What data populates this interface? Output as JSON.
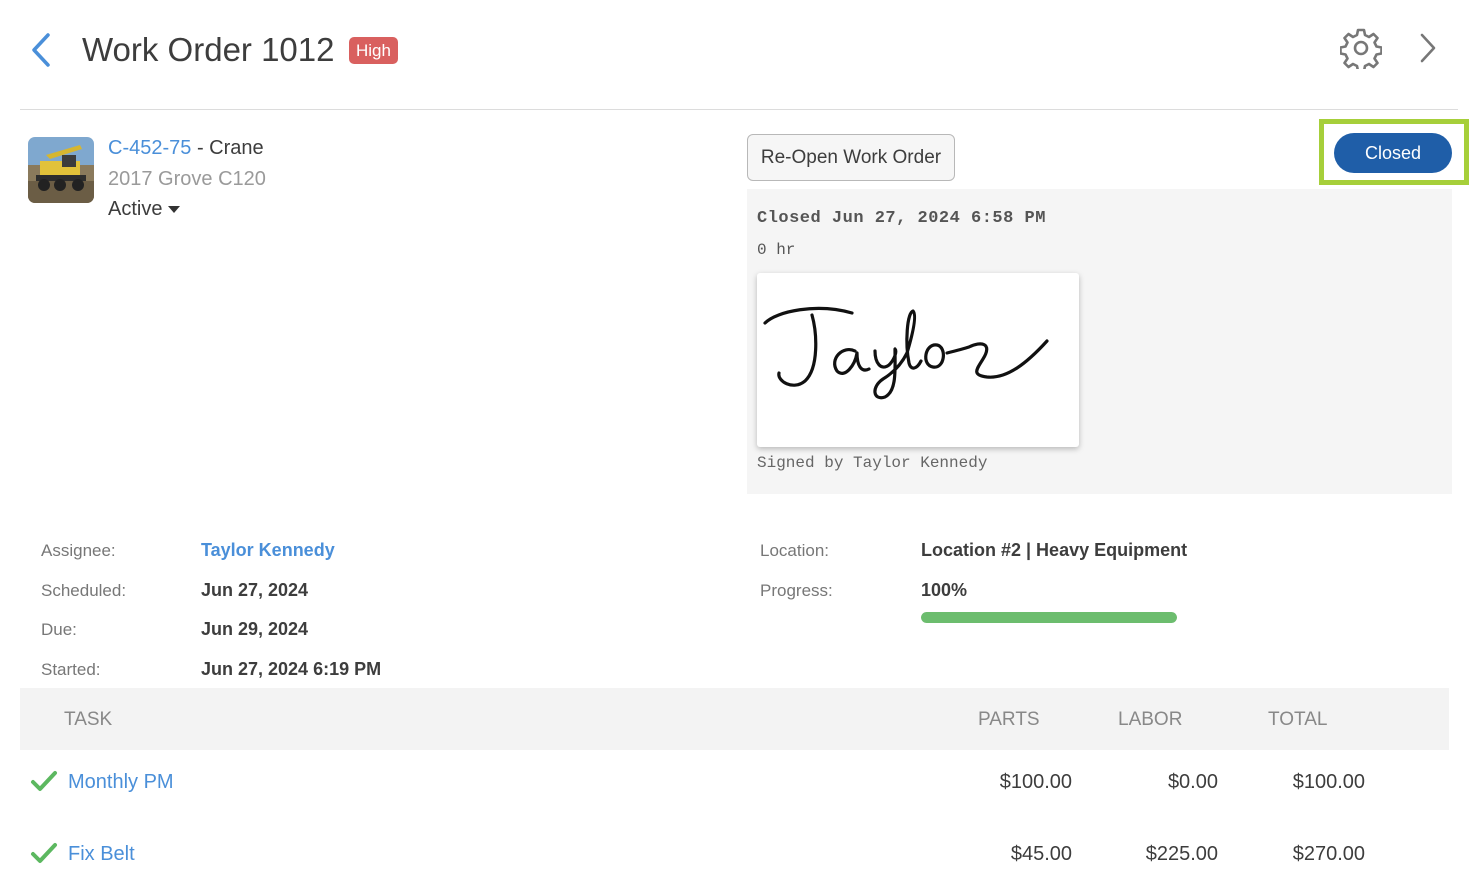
{
  "header": {
    "title": "Work Order 1012",
    "priority": "High"
  },
  "asset": {
    "id": "C-452-75",
    "separator": " - ",
    "name": "Crane",
    "model": "2017 Grove C120",
    "status": "Active"
  },
  "actions": {
    "reopen_label": "Re-Open Work Order",
    "status_label": "Closed"
  },
  "closure": {
    "closed_text": "Closed Jun 27, 2024 6:58 PM",
    "hours_text": "0 hr",
    "signature": "Taylor",
    "signed_by_text": "Signed by Taylor Kennedy"
  },
  "details": {
    "assignee_label": "Assignee:",
    "assignee": "Taylor Kennedy",
    "scheduled_label": "Scheduled:",
    "scheduled": "Jun 27, 2024",
    "due_label": "Due:",
    "due": "Jun 29, 2024",
    "started_label": "Started:",
    "started": "Jun 27, 2024 6:19 PM",
    "location_label": "Location:",
    "location": "Location #2 | Heavy Equipment",
    "progress_label": "Progress:",
    "progress_text": "100%",
    "progress_fraction": 1.0
  },
  "tasks": {
    "columns": {
      "task": "TASK",
      "parts": "PARTS",
      "labor": "LABOR",
      "total": "TOTAL"
    },
    "rows": [
      {
        "name": "Monthly PM",
        "parts": "$100.00",
        "labor": "$0.00",
        "total": "$100.00",
        "done": true
      },
      {
        "name": "Fix Belt",
        "parts": "$45.00",
        "labor": "$225.00",
        "total": "$270.00",
        "done": true
      }
    ]
  },
  "colors": {
    "accent": "#4a8fd9",
    "priority_high": "#d9605f",
    "status_closed": "#1f5ea8",
    "highlight": "#a6cf3a",
    "progress": "#6cbd6e",
    "check": "#5cb860"
  }
}
